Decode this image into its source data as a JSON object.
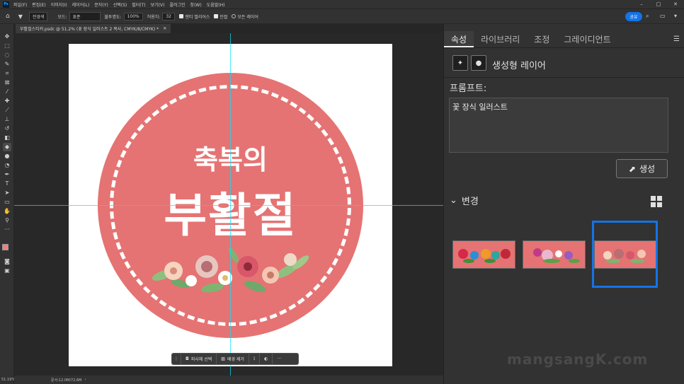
{
  "app": {
    "logo_text": "Ps",
    "menu": [
      "파일(F)",
      "편집(E)",
      "이미지(I)",
      "레이어(L)",
      "문자(Y)",
      "선택(S)",
      "필터(T)",
      "보기(V)",
      "플러그인",
      "창(W)",
      "도움말(H)"
    ],
    "window_controls": [
      "–",
      "□",
      "✕"
    ]
  },
  "options_bar": {
    "tool_preset": "전경색",
    "mode_label": "모드:",
    "mode_value": "표준",
    "opacity_label": "불투명도:",
    "opacity_value": "100%",
    "tolerance_label": "허용치:",
    "tolerance_value": "32",
    "antialias_label": "앤티 앨리어스",
    "contiguous_label": "인접",
    "all_layers_label": "모든 레이어",
    "share_label": "공유"
  },
  "document": {
    "tab_title": "부활절스티커.psdc @ 51.2% (꽃 장식 일러스트 2 복사, CMYK/8/CMYK) *",
    "tab_close": "✕",
    "line1": "축복의",
    "line2": "부활절"
  },
  "context_bar": {
    "select_subject": "피사체 선택",
    "remove_bg": "배경 제거",
    "more": "···"
  },
  "status": {
    "zoom": "51.19%",
    "doc_info": "문서:12.0M/72.6M"
  },
  "panel": {
    "tabs": [
      "속성",
      "라이브러리",
      "조정",
      "그레이디언트"
    ],
    "active_tab": 0,
    "layer_type": "생성형 레이어",
    "prompt_label": "프롬프트:",
    "prompt_value": "꽃 장식 일러스트",
    "generate_label": "생성",
    "variations_label": "변경",
    "selected_variation": 2
  },
  "colors": {
    "badge_pink": "#e57373",
    "accent_blue": "#1473e6",
    "guide_cyan": "#00e5ff",
    "foreground_swatch": "#f08080",
    "background_swatch": "#ffffff"
  },
  "watermark": "mangsangK.com"
}
